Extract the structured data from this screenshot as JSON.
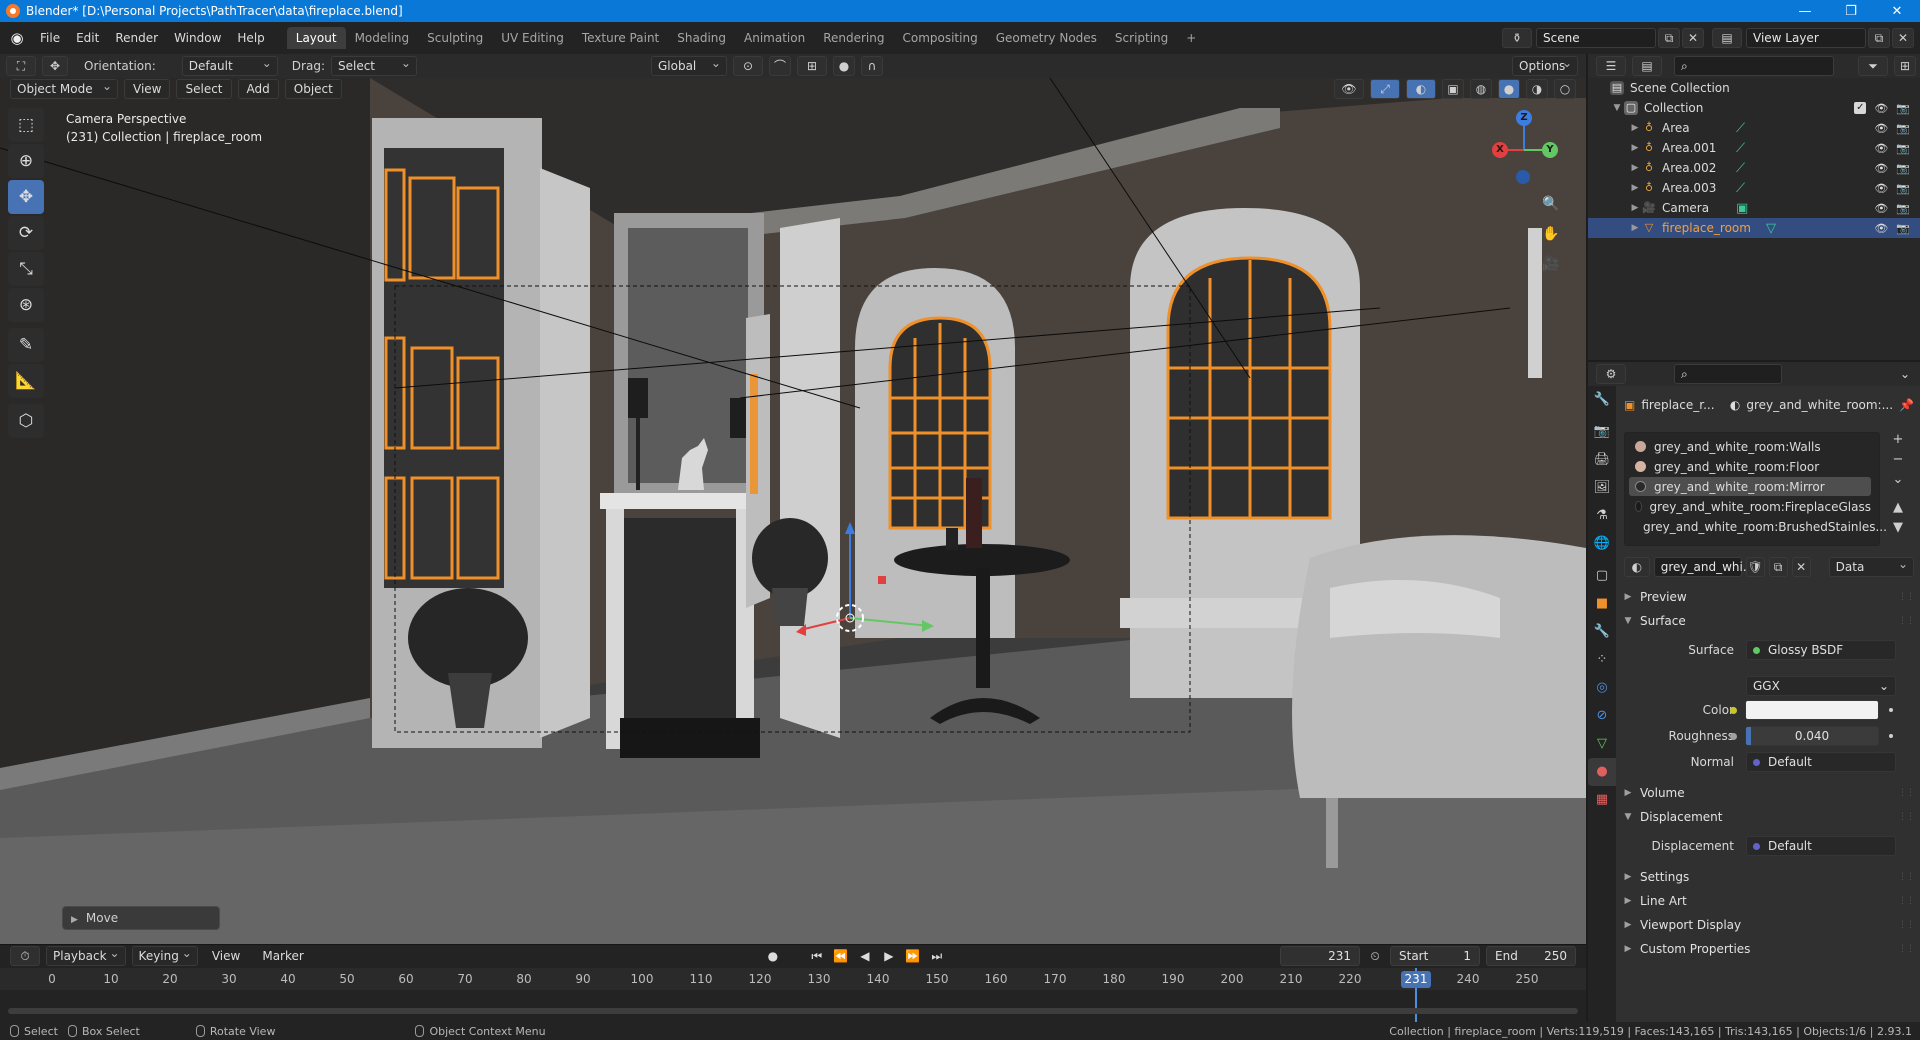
{
  "window": {
    "title": "Blender* [D:\\Personal Projects\\PathTracer\\data\\fireplace.blend]",
    "controls": [
      "—",
      "❐",
      "✕"
    ]
  },
  "topbar": {
    "menus": [
      "File",
      "Edit",
      "Render",
      "Window",
      "Help"
    ],
    "workspaces": [
      "Layout",
      "Modeling",
      "Sculpting",
      "UV Editing",
      "Texture Paint",
      "Shading",
      "Animation",
      "Rendering",
      "Compositing",
      "Geometry Nodes",
      "Scripting"
    ],
    "active_workspace": "Layout",
    "add_workspace": "+",
    "scene": "Scene",
    "view_layer": "View Layer"
  },
  "viewport_header": {
    "orientation_label": "Orientation:",
    "orientation_value": "Default",
    "drag_label": "Drag:",
    "drag_value": "Select Box",
    "transform_orientation": "Global",
    "options": "Options"
  },
  "viewport_menu": {
    "mode": "Object Mode",
    "items": [
      "View",
      "Select",
      "Add",
      "Object"
    ]
  },
  "viewport_info": {
    "line1": "Camera Perspective",
    "line2": "(231) Collection | fireplace_room"
  },
  "gizmo": {
    "x": "X",
    "y": "Y",
    "z": "Z"
  },
  "operator_panel": {
    "label": "Move"
  },
  "timeline": {
    "menus": [
      "Playback",
      "Keying",
      "View",
      "Marker"
    ],
    "current_frame": "231",
    "start_label": "Start",
    "start": "1",
    "end_label": "End",
    "end": "250",
    "ticks": [
      "0",
      "10",
      "20",
      "30",
      "40",
      "50",
      "60",
      "70",
      "80",
      "90",
      "100",
      "110",
      "120",
      "130",
      "140",
      "150",
      "160",
      "170",
      "180",
      "190",
      "200",
      "210",
      "220",
      "231",
      "240",
      "250"
    ]
  },
  "statusbar": {
    "select": "Select",
    "box_select": "Box Select",
    "rotate_view": "Rotate View",
    "context_menu": "Object Context Menu",
    "stats": "Collection | fireplace_room | Verts:119,519 | Faces:143,165 | Tris:143,165 | Objects:1/6 | 2.93.1"
  },
  "outliner": {
    "scene_collection": "Scene Collection",
    "collection": "Collection",
    "items": [
      {
        "name": "Area",
        "type": "light"
      },
      {
        "name": "Area.001",
        "type": "light"
      },
      {
        "name": "Area.002",
        "type": "light"
      },
      {
        "name": "Area.003",
        "type": "light"
      },
      {
        "name": "Camera",
        "type": "camera"
      },
      {
        "name": "fireplace_room",
        "type": "mesh",
        "selected": true
      }
    ]
  },
  "properties": {
    "object_name": "fireplace_r...",
    "material_name": "grey_and_white_room:...",
    "slots": [
      {
        "name": "grey_and_white_room:Walls",
        "color": "#c9a89a"
      },
      {
        "name": "grey_and_white_room:Floor",
        "color": "#d7b3a3"
      },
      {
        "name": "grey_and_white_room:Mirror",
        "color": "#2a2a2a",
        "selected": true
      },
      {
        "name": "grey_and_white_room:FireplaceGlass",
        "color": "#1a1a1a"
      },
      {
        "name": "grey_and_white_room:BrushedStainles...",
        "color": "#111111"
      }
    ],
    "material_field": "grey_and_whi...",
    "link": "Data",
    "sections": {
      "preview": "Preview",
      "surface": "Surface",
      "volume": "Volume",
      "displacement": "Displacement",
      "settings": "Settings",
      "line_art": "Line Art",
      "viewport_display": "Viewport Display",
      "custom_properties": "Custom Properties"
    },
    "surface_rows": {
      "surface_label": "Surface",
      "surface_value": "Glossy BSDF",
      "distribution": "GGX",
      "color_label": "Color",
      "roughness_label": "Roughness",
      "roughness_value": "0.040",
      "roughness_fraction": 0.04,
      "normal_label": "Normal",
      "normal_value": "Default"
    },
    "displacement_rows": {
      "label": "Displacement",
      "value": "Default"
    }
  },
  "colors": {
    "accent": "#4772b3",
    "selection_outline": "#f0902a",
    "title_bar": "#0a78d7",
    "light_icon": "#e8a23c",
    "mesh_icon": "#f0902a",
    "socket_green": "#63c763",
    "socket_yellow": "#c7c729",
    "socket_purple": "#6363c7"
  }
}
